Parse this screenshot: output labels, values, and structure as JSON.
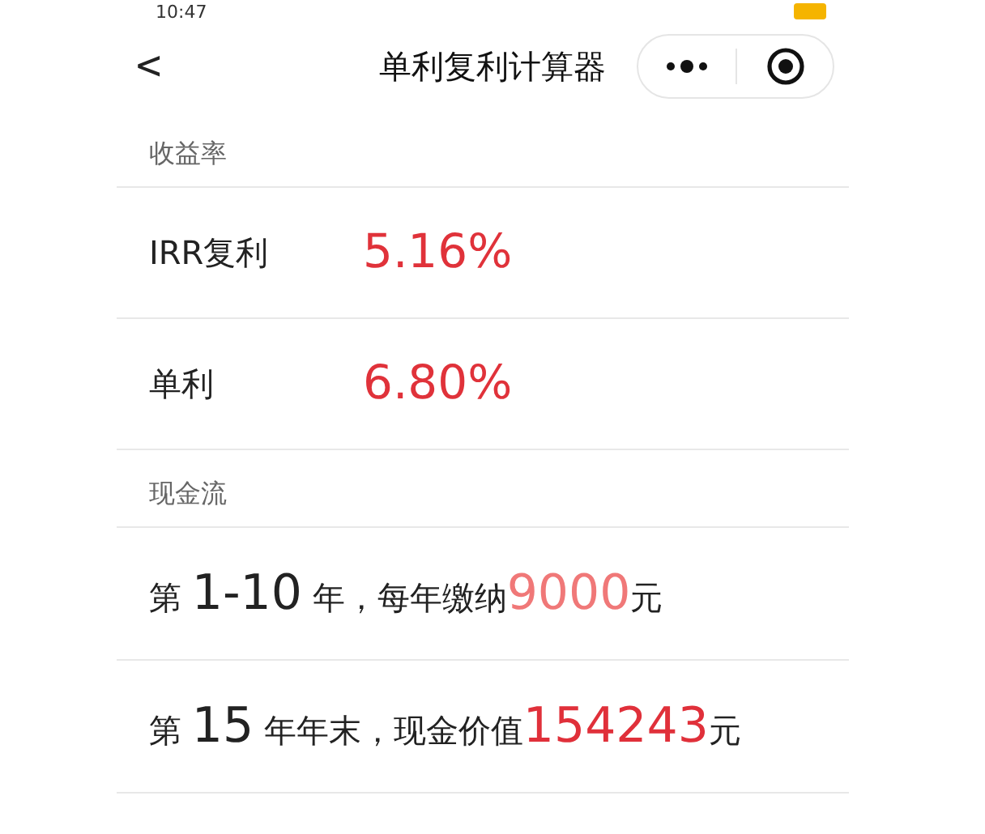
{
  "status_bar": {
    "time": "10:47"
  },
  "nav": {
    "back": "<",
    "title": "单利复利计算器"
  },
  "sections": [
    {
      "header": "收益率",
      "kind": "rates",
      "rows": [
        {
          "label": "IRR复利",
          "value": "5.16%"
        },
        {
          "label": "单利",
          "value": "6.80%"
        }
      ]
    },
    {
      "header": "现金流",
      "kind": "flows",
      "rows": [
        {
          "parts": [
            {
              "text": "第 ",
              "kind": "plain"
            },
            {
              "text": "1-10",
              "kind": "big"
            },
            {
              "text": " 年，每年缴纳",
              "kind": "plain"
            },
            {
              "text": "9000",
              "kind": "soft"
            },
            {
              "text": "元",
              "kind": "plain"
            }
          ]
        },
        {
          "parts": [
            {
              "text": "第 ",
              "kind": "plain"
            },
            {
              "text": "15",
              "kind": "big"
            },
            {
              "text": " 年年末，现金价值",
              "kind": "plain"
            },
            {
              "text": "154243",
              "kind": "strong"
            },
            {
              "text": "元",
              "kind": "plain"
            }
          ]
        }
      ]
    }
  ]
}
